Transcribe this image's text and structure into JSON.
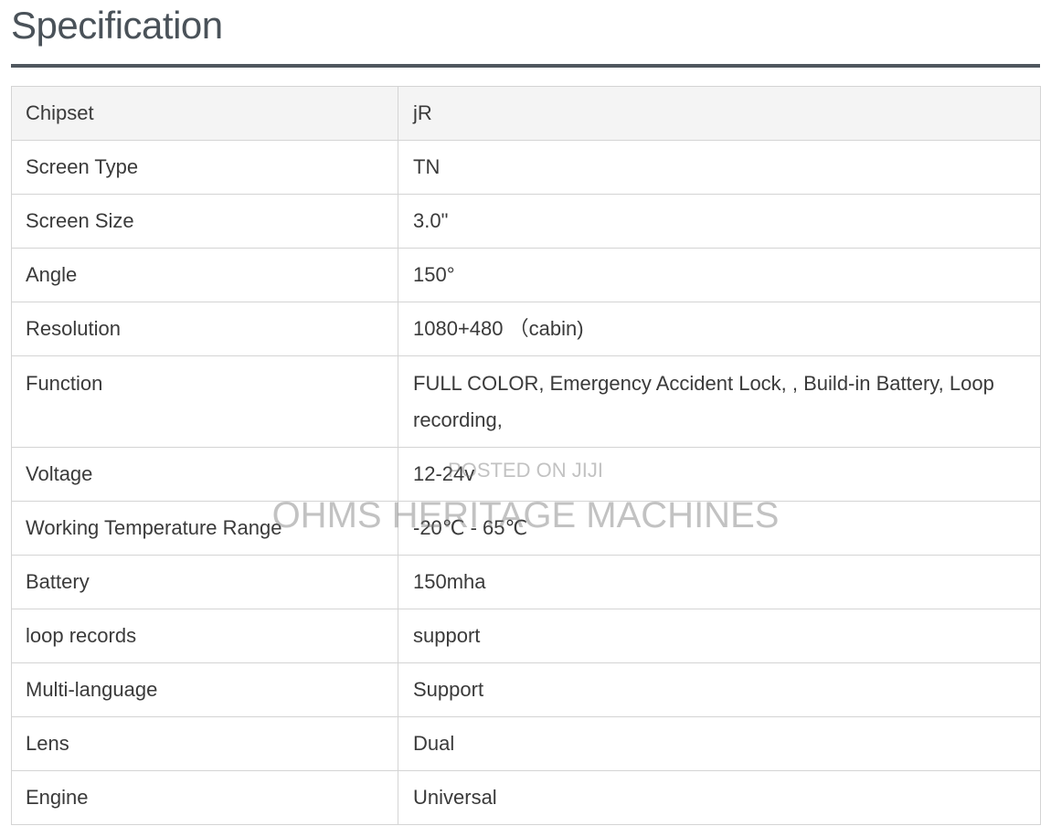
{
  "page": {
    "title": "Specification"
  },
  "spec": {
    "rows": [
      {
        "label": "Chipset",
        "value": "jR"
      },
      {
        "label": "Screen Type",
        "value": "TN"
      },
      {
        "label": "Screen Size",
        "value": "3.0\""
      },
      {
        "label": "Angle",
        "value": "150°"
      },
      {
        "label": "Resolution",
        "value": "1080+480 （cabin)"
      },
      {
        "label": "Function",
        "value": "FULL COLOR, Emergency Accident Lock, , Build-in Battery, Loop recording,"
      },
      {
        "label": "Voltage",
        "value": "12-24v"
      },
      {
        "label": "Working Temperature Range",
        "value": "-20℃ - 65℃"
      },
      {
        "label": "Battery",
        "value": "150mha"
      },
      {
        "label": "loop records",
        "value": "support"
      },
      {
        "label": "Multi-language",
        "value": "Support"
      },
      {
        "label": "Lens",
        "value": "Dual"
      },
      {
        "label": "Engine",
        "value": "Universal"
      }
    ]
  },
  "watermark": {
    "line1": "POSTED ON JIJI",
    "line2": "OHMS HERITAGE MACHINES"
  }
}
